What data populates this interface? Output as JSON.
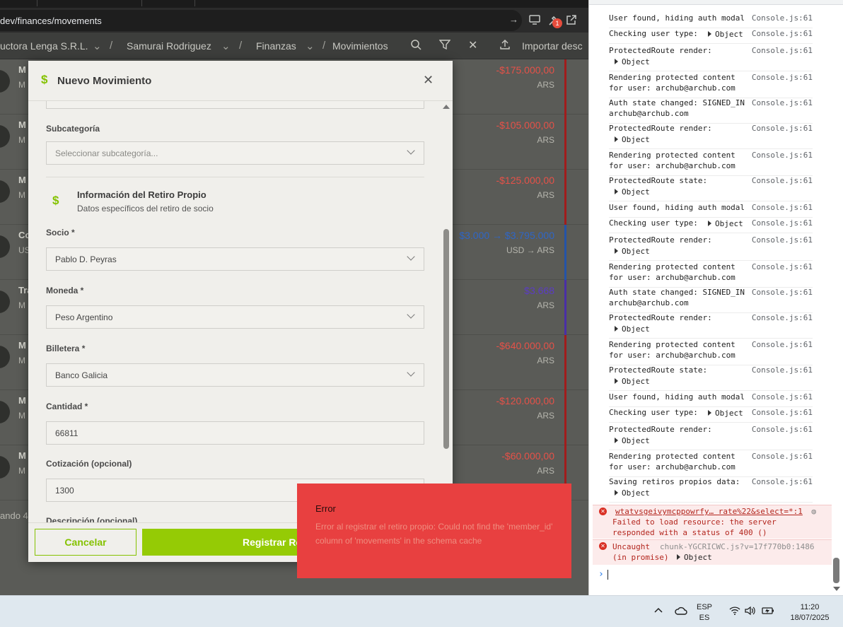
{
  "browser": {
    "address": {
      "domain": "dev",
      "path": "/finances/movements"
    },
    "extension_badge": "1"
  },
  "breadcrumb": {
    "company": "uctora Lenga S.R.L.",
    "user": "Samurai Rodriguez",
    "section": "Finanzas",
    "page": "Movimientos",
    "import_label": "Importar desc"
  },
  "movements": [
    {
      "name": "M",
      "sub": "M",
      "amount": "-$175.000,00",
      "currency": "ARS",
      "color": "#e55148",
      "stripe": "#a11c1c"
    },
    {
      "name": "M",
      "sub": "M",
      "amount": "-$105.000,00",
      "currency": "ARS",
      "color": "#e55148",
      "stripe": "#a11c1c"
    },
    {
      "name": "M",
      "sub": "M",
      "amount": "-$125.000,00",
      "currency": "ARS",
      "color": "#e55148",
      "stripe": "#a11c1c"
    },
    {
      "name": "Co",
      "sub": "US",
      "amount": "$3.000 → $3.795.000",
      "currency": "USD → ARS",
      "color": "#2f66c6",
      "stripe": "#2454a8"
    },
    {
      "name": "Tra",
      "sub": "M",
      "amount": "$3.668",
      "currency": "ARS",
      "color": "#5b3cc4",
      "stripe": "#4a2ea6"
    },
    {
      "name": "M",
      "sub": "M",
      "amount": "-$640.000,00",
      "currency": "ARS",
      "color": "#e55148",
      "stripe": "#a11c1c"
    },
    {
      "name": "M",
      "sub": "M",
      "amount": "-$120.000,00",
      "currency": "ARS",
      "color": "#e55148",
      "stripe": "#a11c1c"
    },
    {
      "name": "M",
      "sub": "M",
      "amount": "-$60.000,00",
      "currency": "ARS",
      "color": "#e55148",
      "stripe": "#a11c1c"
    }
  ],
  "list_footer": "ando 4",
  "modal": {
    "title": "Nuevo Movimiento",
    "subcategory": {
      "label": "Subcategoría",
      "placeholder": "Seleccionar subcategoría..."
    },
    "section": {
      "title": "Información del Retiro Propio",
      "subtitle": "Datos específicos del retiro de socio"
    },
    "partner": {
      "label": "Socio *",
      "value": "Pablo D. Peyras"
    },
    "currency": {
      "label": "Moneda *",
      "value": "Peso Argentino"
    },
    "wallet": {
      "label": "Billetera *",
      "value": "Banco Galicia"
    },
    "amount": {
      "label": "Cantidad *",
      "value": "66811"
    },
    "rate": {
      "label": "Cotización (opcional)",
      "value": "1300"
    },
    "description": {
      "label": "Descripción (opcional)"
    },
    "cancel_label": "Cancelar",
    "submit_label": "Registrar Re"
  },
  "toast": {
    "title": "Error",
    "message": "Error al registrar el retiro propio: Could not find the 'member_id' column of 'movements' in the schema cache"
  },
  "console": {
    "source": "Console.js:61",
    "object": "Object",
    "messages": [
      {
        "text": "User found, hiding auth modal"
      },
      {
        "text": "Checking user type:",
        "inline_obj": true
      },
      {
        "text": "ProtectedRoute render:",
        "obj": true
      },
      {
        "text": "Rendering protected content\nfor user: archub@archub.com"
      },
      {
        "text": "Auth state changed: SIGNED_IN\narchub@archub.com"
      },
      {
        "text": "ProtectedRoute render:",
        "obj": true
      },
      {
        "text": "Rendering protected content\nfor user: archub@archub.com"
      },
      {
        "text": "ProtectedRoute state:",
        "obj": true
      },
      {
        "text": "User found, hiding auth modal"
      },
      {
        "text": "Checking user type:",
        "inline_obj": true
      },
      {
        "text": "ProtectedRoute render:",
        "obj": true
      },
      {
        "text": "Rendering protected content\nfor user: archub@archub.com"
      },
      {
        "text": "Auth state changed: SIGNED_IN\narchub@archub.com"
      },
      {
        "text": "ProtectedRoute render:",
        "obj": true
      },
      {
        "text": "Rendering protected content\nfor user: archub@archub.com"
      },
      {
        "text": "ProtectedRoute state:",
        "obj": true
      },
      {
        "text": "User found, hiding auth modal"
      },
      {
        "text": "Checking user type:",
        "inline_obj": true
      },
      {
        "text": "ProtectedRoute render:",
        "obj": true
      },
      {
        "text": "Rendering protected content\nfor user: archub@archub.com"
      },
      {
        "text": "Saving retiros propios data:",
        "obj": true
      }
    ],
    "error1": {
      "link": "wtatvsgeivymcppowrfy… rate%22&select=*:1",
      "text": "Failed to load resource: the server\nresponded with a status of 400 ()"
    },
    "error2": {
      "text": "Uncaught\n(in promise)",
      "source": "chunk-YGCRICWC.js?v=17f770b0:1486",
      "object": "Object"
    }
  },
  "taskbar": {
    "lang": "ESP",
    "region": "ES",
    "time": "11:20",
    "date": "18/07/2025"
  }
}
